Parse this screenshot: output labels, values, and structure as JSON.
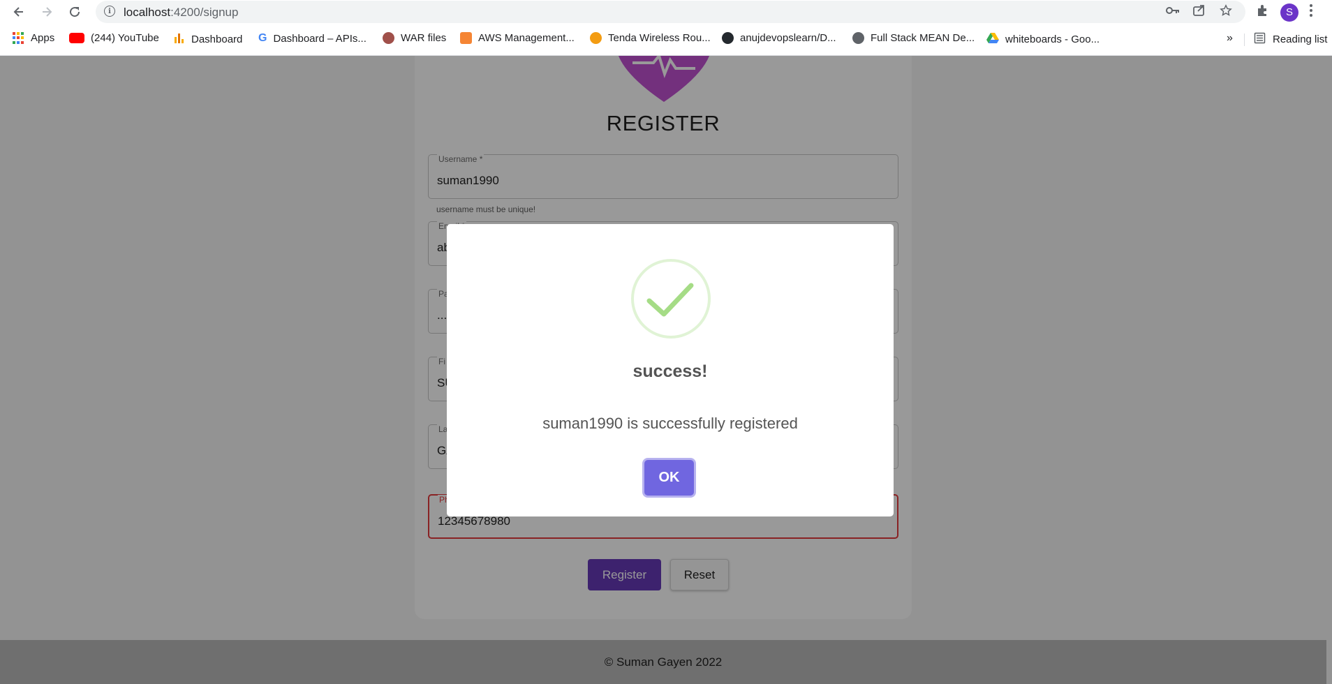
{
  "browser": {
    "url_host": "localhost",
    "url_path": ":4200/signup",
    "avatar_letter": "S",
    "bookmarks": [
      {
        "label": "Apps",
        "icon": "apps-grid-icon"
      },
      {
        "label": "(244) YouTube",
        "icon": "youtube-icon"
      },
      {
        "label": "Dashboard",
        "icon": "dashboard-icon"
      },
      {
        "label": "Dashboard – APIs...",
        "icon": "google-icon"
      },
      {
        "label": "WAR files",
        "icon": "jenkins-icon"
      },
      {
        "label": "AWS Management...",
        "icon": "aws-icon"
      },
      {
        "label": "Tenda Wireless Rou...",
        "icon": "tenda-icon"
      },
      {
        "label": "anujdevopslearn/D...",
        "icon": "github-icon"
      },
      {
        "label": "Full Stack MEAN De...",
        "icon": "globe-icon"
      },
      {
        "label": "whiteboards - Goo...",
        "icon": "google-drive-icon"
      }
    ],
    "more_label": "»",
    "reading_list_label": "Reading list"
  },
  "form": {
    "title": "REGISTER",
    "username": {
      "label": "Username *",
      "value": "suman1990",
      "hint": "username must be unique!"
    },
    "email": {
      "label": "Email *",
      "value": "ab"
    },
    "password": {
      "label": "Pa",
      "value": "..."
    },
    "first_name": {
      "label": "Fi",
      "value": "SU"
    },
    "last_name": {
      "label": "La",
      "value": "GA"
    },
    "phone": {
      "label": "Ph",
      "value": "12345678980"
    },
    "register_label": "Register",
    "reset_label": "Reset"
  },
  "footer": {
    "text": "© Suman Gayen 2022"
  },
  "dialog": {
    "title": "success!",
    "message": "suman1990 is successfully registered",
    "ok_label": "OK"
  },
  "colors": {
    "primary": "#673ab7",
    "confirm": "#7066e0",
    "error": "#e5393d",
    "success": "#a5dc86"
  }
}
